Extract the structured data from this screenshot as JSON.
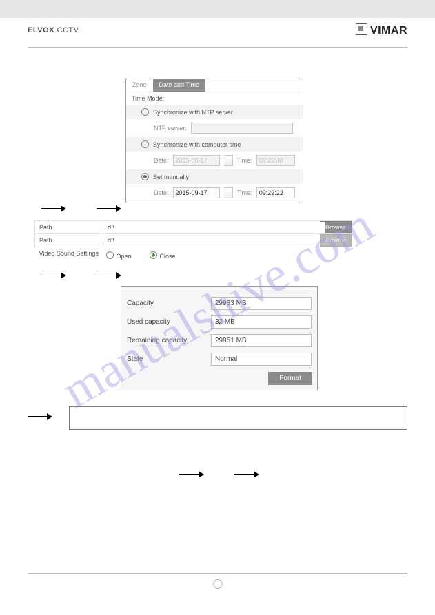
{
  "header": {
    "brand_left_bold": "ELVOX",
    "brand_left_rest": " CCTV",
    "brand_right": "VIMAR"
  },
  "watermark": "manualshive.com",
  "panel1": {
    "tabs": {
      "zone": "Zone",
      "datetime": "Date and Time"
    },
    "title": "Time Mode:",
    "opt_ntp": "Synchronize with NTP server",
    "ntp_label": "NTP server:",
    "opt_pc": "Synchronize with computer time",
    "pc_date_label": "Date:",
    "pc_date_val": "2015-08-17",
    "pc_time_label": "Time:",
    "pc_time_val": "09:23:40",
    "opt_manual": "Set manually",
    "man_date_label": "Date:",
    "man_date_val": "2015-09-17",
    "man_time_label": "Time:",
    "man_time_val": "09:22:22"
  },
  "sec2": {
    "row1_label": "Path",
    "row1_val": "d:\\",
    "row2_label": "Path",
    "row2_val": "d:\\",
    "browse": "Browse",
    "vss_label": "Video Sound Settings",
    "open": "Open",
    "close": "Close"
  },
  "sec3": {
    "cap_l": "Capacity",
    "cap_v": "29983 MB",
    "used_l": "Used capacity",
    "used_v": "32 MB",
    "rem_l": "Remaining capacity",
    "rem_v": "29951 MB",
    "state_l": "State",
    "state_v": "Normal",
    "format": "Format"
  }
}
